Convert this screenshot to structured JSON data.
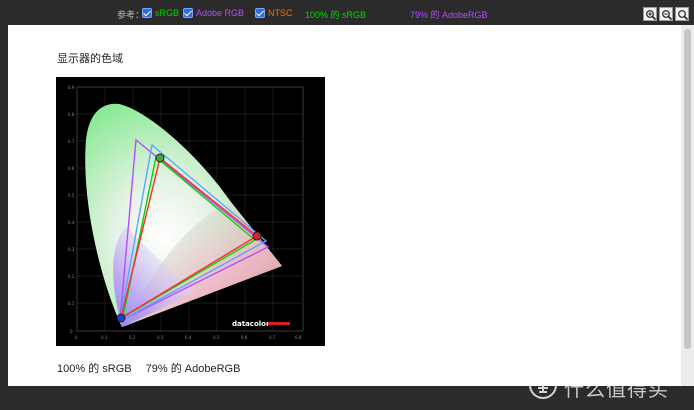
{
  "toolbar": {
    "reference_label": "参考：",
    "options": [
      {
        "label": "sRGB",
        "checked": true,
        "color": "#00d800"
      },
      {
        "label": "Adobe RGB",
        "checked": true,
        "color": "#b34dff"
      },
      {
        "label": "NTSC",
        "checked": true,
        "color": "#ff6a00"
      }
    ],
    "srgb_stat": "100% 的 sRGB",
    "adobe_stat": "79% 的 AdobeRGB",
    "zoom_in_icon": "zoom-in-icon",
    "zoom_out_icon": "zoom-out-icon",
    "zoom_reset_icon": "zoom-fit-icon"
  },
  "panel": {
    "title": "显示器的色域",
    "caption": "100% 的 sRGB　 79% 的 AdobeRGB",
    "chart_brand": "datacolor",
    "chart_ticks_x": [
      "0",
      "0.1",
      "0.2",
      "0.3",
      "0.4",
      "0.5",
      "0.6",
      "0.7",
      "0.8"
    ],
    "chart_ticks_y": [
      "0.9",
      "0.8",
      "0.7",
      "0.6",
      "0.5",
      "0.4",
      "0.3",
      "0.2",
      "0.1",
      "0"
    ]
  },
  "watermark": {
    "text": "什么值得买",
    "icon": "smzdm-logo-icon"
  }
}
